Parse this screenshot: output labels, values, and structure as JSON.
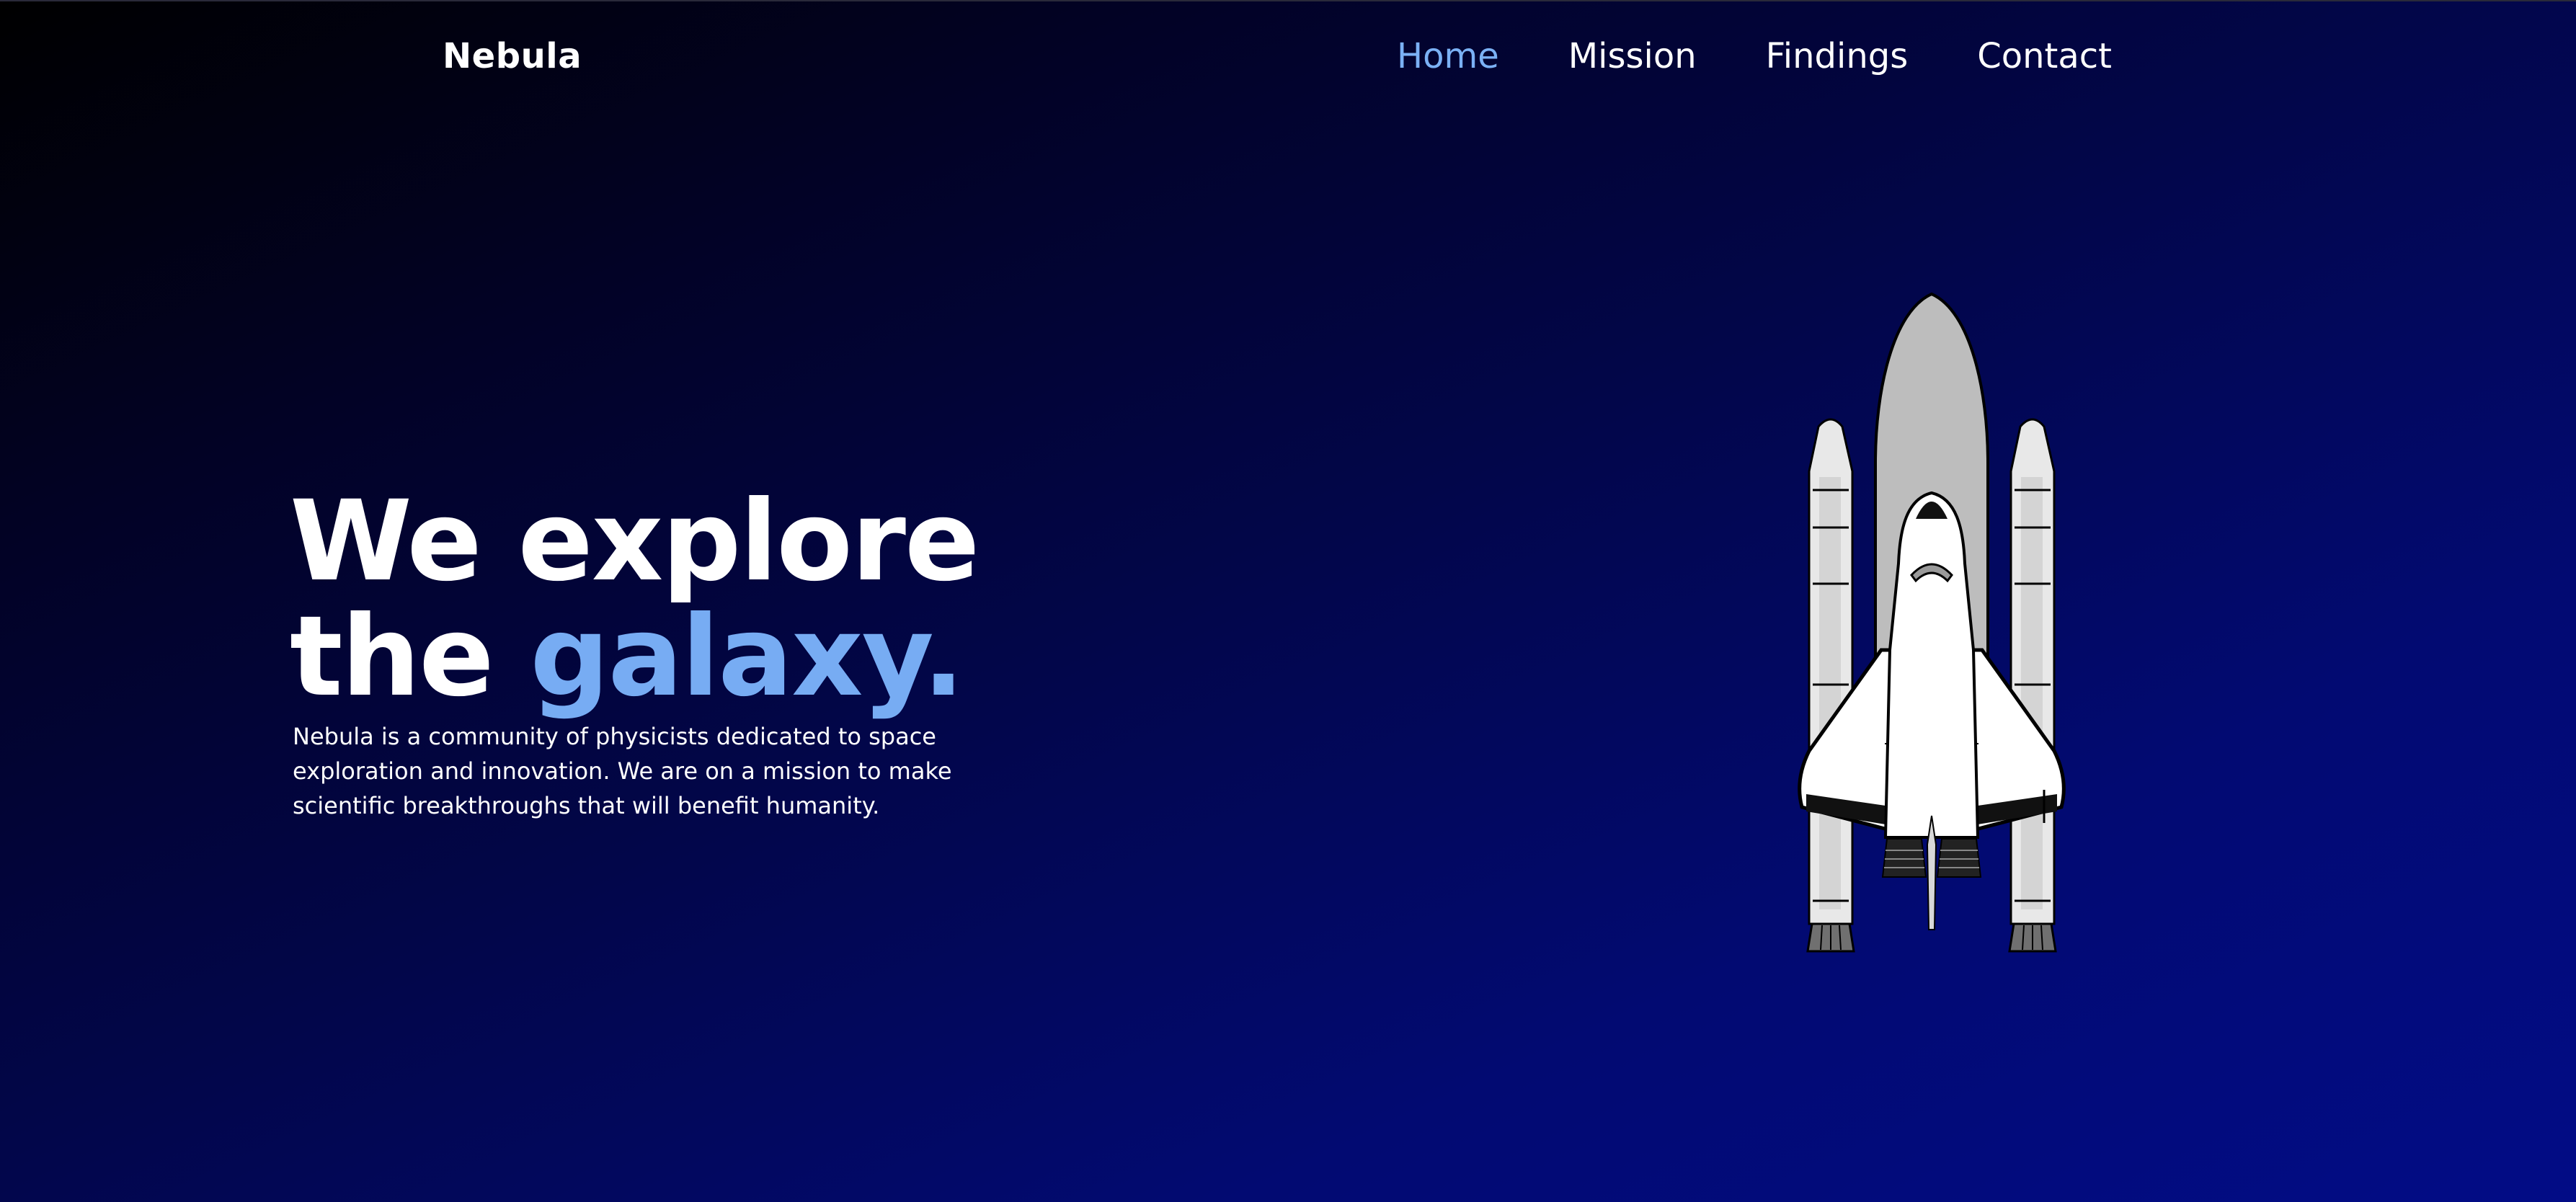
{
  "header": {
    "brand": "Nebula"
  },
  "nav": {
    "items": [
      {
        "label": "Home",
        "active": true
      },
      {
        "label": "Mission",
        "active": false
      },
      {
        "label": "Findings",
        "active": false
      },
      {
        "label": "Contact",
        "active": false
      }
    ]
  },
  "hero": {
    "title_line1": "We explore",
    "title_line2_prefix": "the ",
    "title_line2_accent": "galaxy.",
    "description": "Nebula is a community of physicists dedicated to space exploration and innovation. We are on a mission to make scientific breakthroughs that will benefit humanity."
  },
  "illustration": {
    "icon": "space-shuttle-icon"
  },
  "colors": {
    "accent": "#77acf3",
    "text": "#ffffff",
    "background_start": "#000000",
    "background_end": "#020c86"
  }
}
